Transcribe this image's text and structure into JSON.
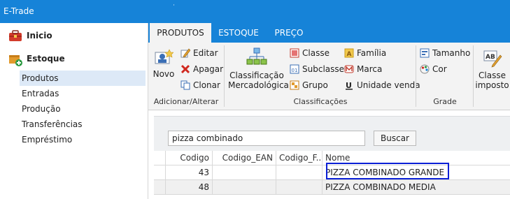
{
  "window": {
    "title": "E-Trade",
    "dot": "˙"
  },
  "sidebar": {
    "sections": [
      {
        "label": "Inicio",
        "icon": "toolbox-icon"
      },
      {
        "label": "Estoque",
        "icon": "box-add-icon"
      }
    ],
    "items": [
      {
        "label": "Produtos",
        "active": true
      },
      {
        "label": "Entradas"
      },
      {
        "label": "Produção"
      },
      {
        "label": "Transferências"
      },
      {
        "label": "Empréstimo"
      }
    ]
  },
  "ribbon": {
    "tabs": [
      {
        "label": "PRODUTOS",
        "active": true
      },
      {
        "label": "ESTOQUE"
      },
      {
        "label": "PREÇO"
      }
    ],
    "groups": {
      "adicionar": {
        "label": "Adicionar/Alterar",
        "novo": "Novo",
        "editar": "Editar",
        "apagar": "Apagar",
        "clonar": "Clonar"
      },
      "classificacoes": {
        "label": "Classificações",
        "classificacao_line1": "Classificação",
        "classificacao_line2": "Mercadológica",
        "classe": "Classe",
        "subclasse": "Subclasse",
        "grupo": "Grupo",
        "familia": "Família",
        "marca": "Marca",
        "unidade_venda": "Unidade venda"
      },
      "grade": {
        "label": "Grade",
        "tamanho": "Tamanho",
        "cor": "Cor"
      },
      "imposto": {
        "line1": "Classe",
        "line2": "imposto"
      }
    }
  },
  "search": {
    "value": "pizza combinado",
    "button_label": "Buscar"
  },
  "grid": {
    "columns": [
      "Codigo",
      "Codigo_EAN",
      "Codigo_F...",
      "Nome"
    ],
    "rows": [
      {
        "codigo": "43",
        "ean": "",
        "cf": "",
        "nome": "PIZZA COMBINADO GRANDE",
        "selected": true
      },
      {
        "codigo": "48",
        "ean": "",
        "cf": "",
        "nome": "PIZZA COMBINADO MEDIA"
      }
    ]
  },
  "colors": {
    "accent": "#1683d8",
    "highlight": "#0a1fd6"
  }
}
